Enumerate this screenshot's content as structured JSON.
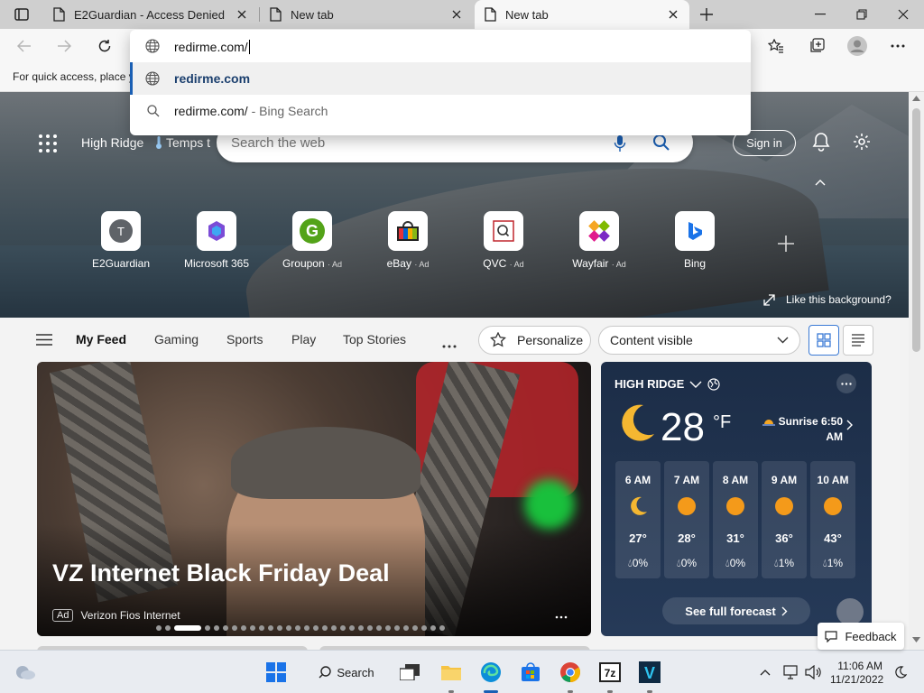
{
  "tabs": [
    {
      "title": "E2Guardian - Access Denied",
      "active": false
    },
    {
      "title": "New tab",
      "active": false
    },
    {
      "title": "New tab",
      "active": true
    }
  ],
  "favorites_bar": {
    "text": "For quick access, place y"
  },
  "omnibox": {
    "value": "redirme.com/",
    "suggestions": [
      {
        "text": "redirme.com",
        "suffix": "",
        "icon": "globe-icon",
        "selected": true
      },
      {
        "text": "redirme.com/",
        "suffix": " - Bing Search",
        "icon": "search-icon",
        "selected": false
      }
    ]
  },
  "newtab": {
    "location": "High Ridge",
    "temps": "Temps t",
    "search_placeholder": "Search the web",
    "signin": "Sign in",
    "quick_links": [
      {
        "label": "E2Guardian",
        "ad": "",
        "icon": "e2guardian-icon"
      },
      {
        "label": "Microsoft 365",
        "ad": "",
        "icon": "microsoft365-icon"
      },
      {
        "label": "Groupon",
        "ad": "Ad",
        "icon": "groupon-icon"
      },
      {
        "label": "eBay",
        "ad": "Ad",
        "icon": "ebay-icon"
      },
      {
        "label": "QVC",
        "ad": "Ad",
        "icon": "qvc-icon"
      },
      {
        "label": "Wayfair",
        "ad": "Ad",
        "icon": "wayfair-icon"
      },
      {
        "label": "Bing",
        "ad": "",
        "icon": "bing-icon"
      }
    ],
    "like_background": "Like this background?"
  },
  "feed_nav": {
    "items": [
      "My Feed",
      "Gaming",
      "Sports",
      "Play",
      "Top Stories"
    ],
    "personalize": "Personalize",
    "content_visible": "Content visible"
  },
  "main_card": {
    "title": "VZ Internet Black Friday Deal",
    "ad_label": "Ad",
    "source": "Verizon Fios Internet"
  },
  "weather": {
    "location": "HIGH RIDGE",
    "temp": "28",
    "unit": "°F",
    "sunrise": "Sunrise 6:50 AM",
    "hours": [
      {
        "time": "6 AM",
        "icon": "moon-icon",
        "temp": "27°",
        "precip": "0%"
      },
      {
        "time": "7 AM",
        "icon": "sun-icon",
        "temp": "28°",
        "precip": "0%"
      },
      {
        "time": "8 AM",
        "icon": "sun-icon",
        "temp": "31°",
        "precip": "0%"
      },
      {
        "time": "9 AM",
        "icon": "sun-icon",
        "temp": "36°",
        "precip": "1%"
      },
      {
        "time": "10 AM",
        "icon": "sun-icon",
        "temp": "43°",
        "precip": "1%"
      }
    ],
    "forecast_button": "See full forecast"
  },
  "feedback": "Feedback",
  "taskbar": {
    "search": "Search",
    "time": "11:06 AM",
    "date": "11/21/2022"
  },
  "colors": {
    "accent": "#1a5fb4",
    "weather_card": "#1c2d47",
    "sun": "#f49a1a"
  }
}
